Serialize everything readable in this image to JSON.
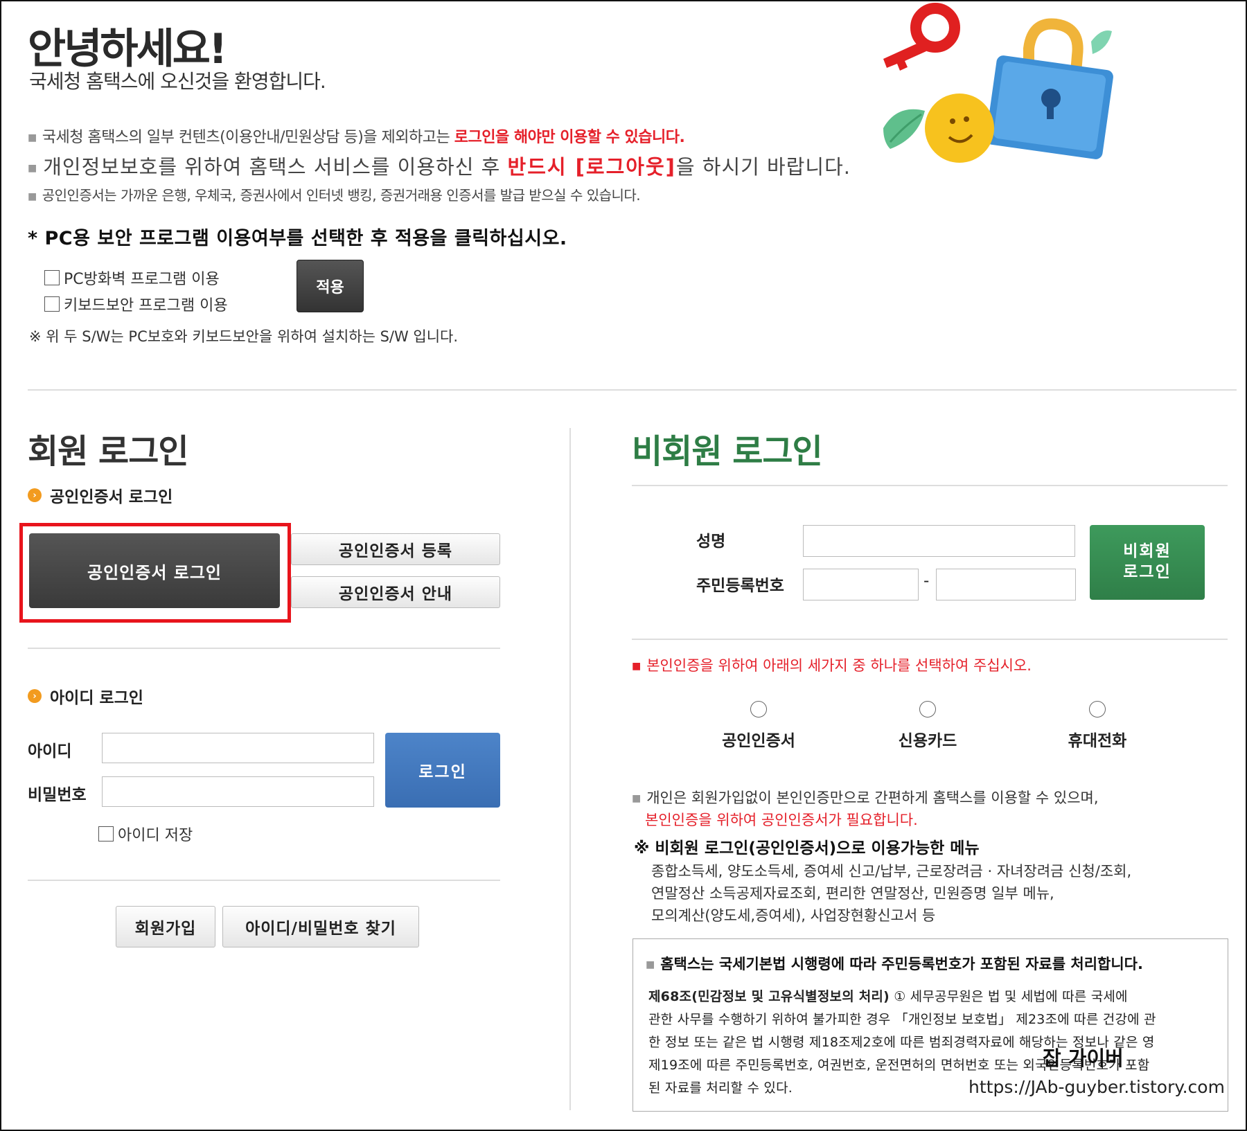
{
  "header": {
    "greeting": "안녕하세요!",
    "welcome": "국세청 홈택스에 오신것을 환영합니다.",
    "note1_prefix": "국세청 홈택스의 일부 컨텐츠(이용안내/민원상담 등)을 제외하고는 ",
    "note1_emph": "로그인을 해야만 이용할 수 있습니다.",
    "note2_prefix": "개인정보보호를 위하여 홈택스 서비스를 이용하신 후 ",
    "note2_emph": "반드시 [로그아웃]",
    "note2_suffix": "을 하시기 바랍니다.",
    "note3": "공인인증서는 가까운 은행, 우체국, 증권사에서 인터넷 뱅킹, 증권거래용 인증서를 발급 받으실 수 있습니다."
  },
  "security": {
    "title": "* PC용 보안 프로그램 이용여부를 선택한 후 적용을 클릭하십시오.",
    "option1": "PC방화벽 프로그램 이용",
    "option2": "키보드보안 프로그램 이용",
    "apply_label": "적용",
    "sw_note": "※ 위 두 S/W는 PC보호와 키보드보안을 위하여 설치하는 S/W 입니다."
  },
  "member": {
    "title": "회원 로그인",
    "cert_section": "공인인증서 로그인",
    "cert_login_button": "공인인증서 로그인",
    "cert_register_button": "공인인증서 등록",
    "cert_guide_button": "공인인증서 안내",
    "id_section": "아이디 로그인",
    "id_label": "아이디",
    "pw_label": "비밀번호",
    "login_button": "로그인",
    "save_id": "아이디 저장",
    "join_button": "회원가입",
    "find_button": "아이디/비밀번호 찾기"
  },
  "nonmember": {
    "title": "비회원 로그인",
    "name_label": "성명",
    "rrn_label": "주민등록번호",
    "rrn_sep": "-",
    "login_line1": "비회원",
    "login_line2": "로그인",
    "verify_notice": "본인인증을 위하여 아래의 세가지 중 하나를 선택하여 주십시오.",
    "options": [
      "공인인증서",
      "신용카드",
      "휴대전화"
    ],
    "info_line1": "개인은 회원가입없이 본인인증만으로 간편하게 홈택스를 이용할 수 있으며,",
    "info_line2": "본인인증을 위하여 공인인증서가 필요합니다.",
    "menu_title": "※ 비회원 로그인(공인인증서)으로 이용가능한 메뉴",
    "menu_lines": [
      "종합소득세, 양도소득세, 증여세 신고/납부, 근로장려금 · 자녀장려금 신청/조회,",
      "연말정산 소득공제자료조회, 편리한 연말정산, 민원증명 일부 메뉴,",
      "모의계산(양도세,증여세), 사업장현황신고서 등"
    ],
    "law_title": "홈택스는 국세기본법 시행령에 따라 주민등록번호가 포함된 자료를 처리합니다.",
    "law_article": "제68조(민감정보 및 고유식별정보의 처리)",
    "law_lines": [
      "① 세무공무원은 법 및 세법에 따른 국세에",
      "관한 사무를 수행하기 위하여 불가피한 경우 「개인정보 보호법」 제23조에 따른 건강에 관",
      "한 정보 또는 같은 법 시행령 제18조제2호에 따른 범죄경력자료에 해당하는 정보나 같은 영",
      "제19조에 따른 주민등록번호, 여권번호, 운전면허의 면허번호 또는 외국인등록번호가 포함",
      "된 자료를 처리할 수 있다."
    ]
  },
  "watermark": {
    "name": "잡 가이버",
    "url": "https://JAb-guyber.tistory.com"
  },
  "colors": {
    "emphasis_red": "#e5202a",
    "highlight_box": "#e8141c",
    "login_blue": "#3a6eb3",
    "nonmember_green": "#2e7d45",
    "bullet_orange": "#f29b1f"
  }
}
